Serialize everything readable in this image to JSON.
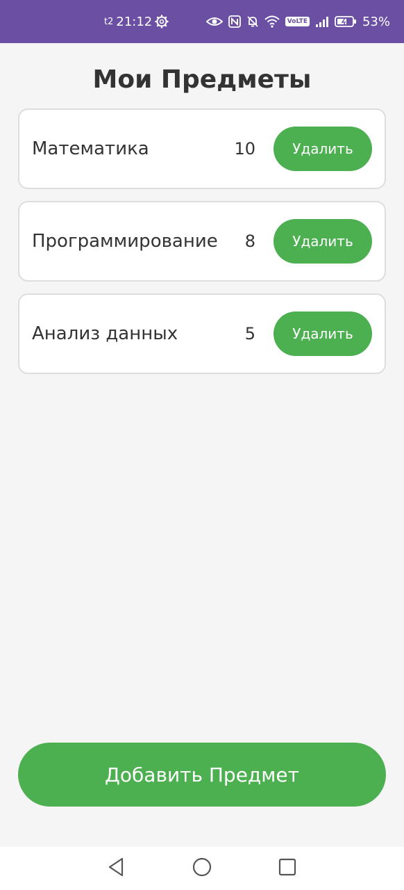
{
  "status_bar": {
    "carrier": "t2",
    "time": "21:12",
    "battery": "53%",
    "volte": "VoLTE",
    "icons": [
      "gear-icon",
      "eye-icon",
      "nfc-icon",
      "bell-off-icon",
      "wifi-icon",
      "volte-icon",
      "signal-icon",
      "battery-icon"
    ]
  },
  "page": {
    "title": "Мои Предметы"
  },
  "subjects": [
    {
      "name": "Математика",
      "count": "10",
      "delete_label": "Удалить"
    },
    {
      "name": "Программирование",
      "count": "8",
      "delete_label": "Удалить"
    },
    {
      "name": "Анализ данных",
      "count": "5",
      "delete_label": "Удалить"
    }
  ],
  "actions": {
    "add_label": "Добавить Предмет"
  },
  "colors": {
    "status_bar": "#6a4fa3",
    "accent": "#4caf50",
    "background": "#f5f5f5",
    "card": "#ffffff",
    "text": "#333333"
  },
  "nav_bar": {
    "icons": [
      "back-icon",
      "home-icon",
      "recents-icon"
    ]
  }
}
